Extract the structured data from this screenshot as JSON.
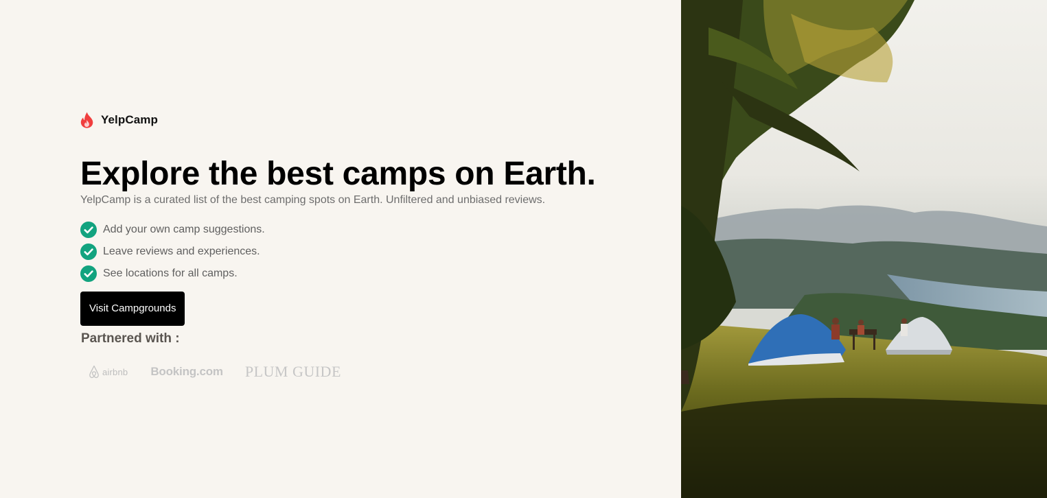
{
  "brand": {
    "name": "YelpCamp",
    "icon": "flame-icon",
    "icon_color": "#f03e3e"
  },
  "hero": {
    "headline": "Explore the best camps on Earth.",
    "subtitle": "YelpCamp is a curated list of the best camping spots on Earth. Unfiltered and unbiased reviews."
  },
  "features": [
    {
      "text": "Add your own camp suggestions.",
      "icon": "check-circle-icon"
    },
    {
      "text": "Leave reviews and experiences.",
      "icon": "check-circle-icon"
    },
    {
      "text": "See locations for all camps.",
      "icon": "check-circle-icon"
    }
  ],
  "cta": {
    "label": "Visit Campgrounds"
  },
  "partners": {
    "title": "Partnered with :",
    "logos": [
      {
        "name": "airbnb",
        "icon": "airbnb-logo-icon"
      },
      {
        "name": "Booking.com"
      },
      {
        "name": "PLUM GUIDE"
      }
    ]
  },
  "colors": {
    "background": "#f8f5f0",
    "check": "#12a37f",
    "button": "#000000",
    "accent": "#f03e3e"
  },
  "image": {
    "icon": "campsite-photo-icon"
  }
}
